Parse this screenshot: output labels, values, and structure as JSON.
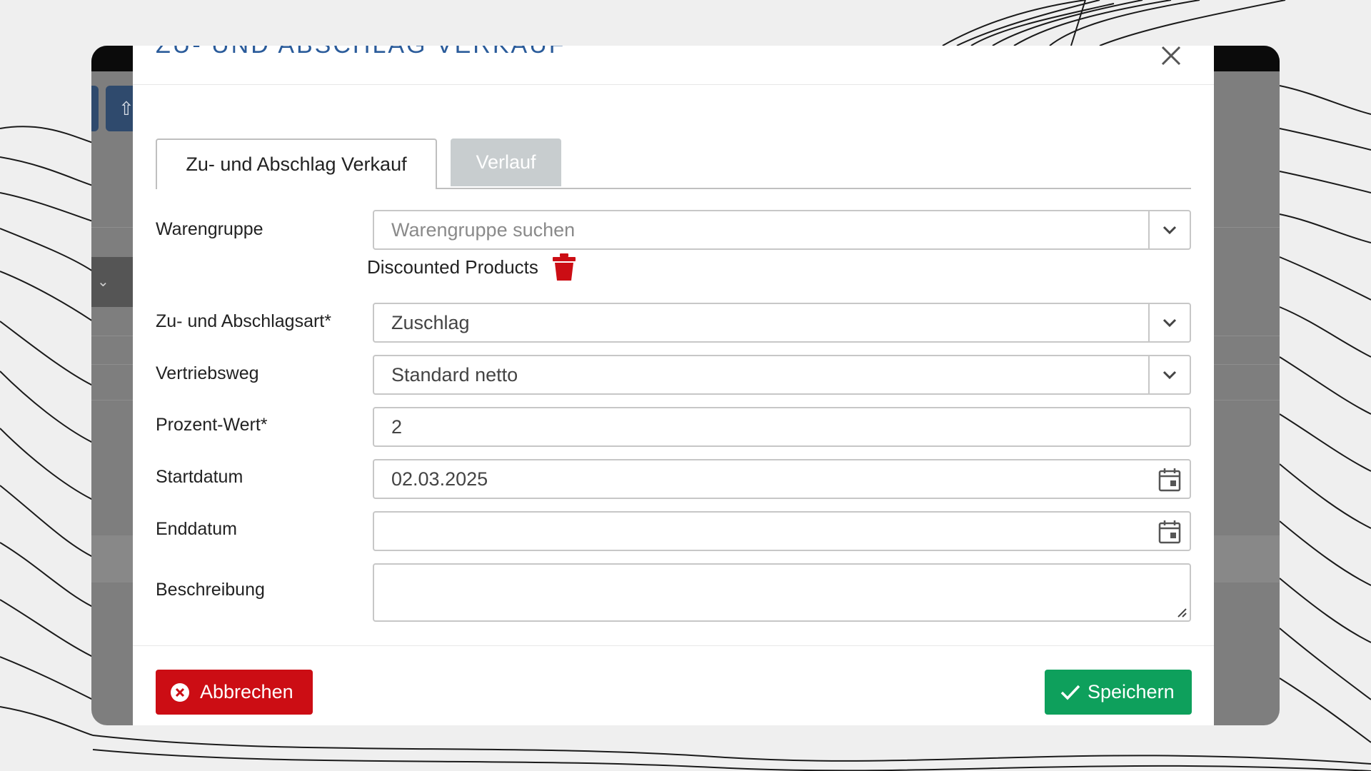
{
  "modal": {
    "title": "Zu- und Abschlag Verkauf",
    "tabs": [
      {
        "label": "Zu- und Abschlag Verkauf",
        "active": true
      },
      {
        "label": "Verlauf",
        "active": false
      }
    ]
  },
  "form": {
    "warengruppe": {
      "label": "Warengruppe",
      "placeholder": "Warengruppe suchen",
      "selected_tag": "Discounted Products"
    },
    "art": {
      "label": "Zu- und Abschlagsart*",
      "value": "Zuschlag"
    },
    "vertriebsweg": {
      "label": "Vertriebsweg",
      "value": "Standard netto"
    },
    "prozent": {
      "label": "Prozent-Wert*",
      "value": "2"
    },
    "startdatum": {
      "label": "Startdatum",
      "value": "02.03.2025"
    },
    "enddatum": {
      "label": "Enddatum",
      "value": ""
    },
    "beschreibung": {
      "label": "Beschreibung",
      "value": ""
    }
  },
  "buttons": {
    "cancel_label": "Abbrechen",
    "save_label": "Speichern"
  },
  "colors": {
    "cancel": "#cc0d14",
    "save": "#0ea05c",
    "title": "#2a5b9a",
    "tab_inactive": "#c8cdcf"
  }
}
